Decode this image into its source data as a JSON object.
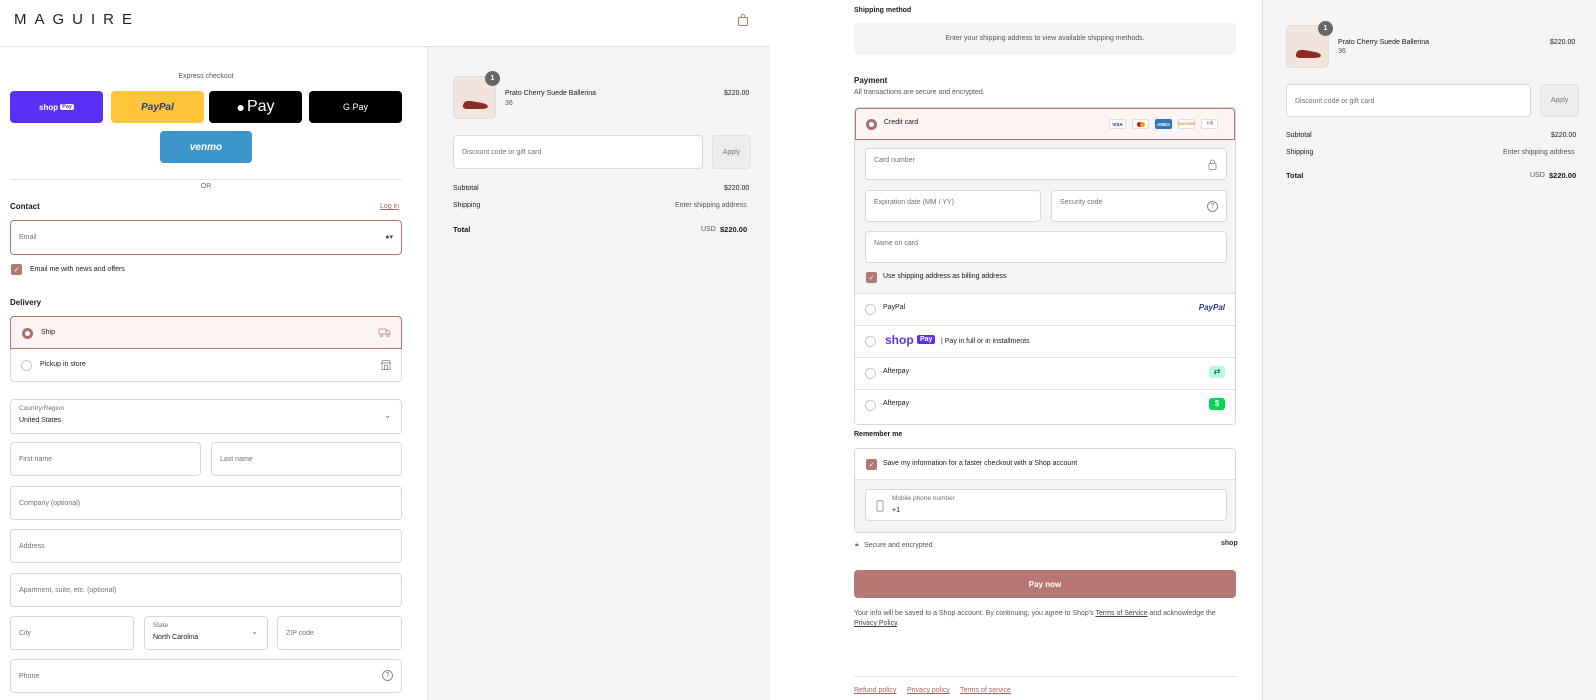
{
  "store": {
    "logo": "MAGUIRE"
  },
  "express": {
    "label": "Express checkout",
    "shop_pay": "shop",
    "shop_pay_badge": "Pay",
    "paypal": "PayPal",
    "apple_pay": "Pay",
    "google_pay": "G Pay",
    "venmo": "venmo",
    "or": "OR"
  },
  "contact": {
    "heading": "Contact",
    "login": "Log in",
    "email_placeholder": "Email",
    "news_label": "Email me with news and offers"
  },
  "delivery": {
    "heading": "Delivery",
    "ship": "Ship",
    "pickup": "Pickup in store",
    "country_label": "Country/Region",
    "country_value": "United States",
    "first_name": "First name",
    "last_name": "Last name",
    "company": "Company (optional)",
    "address": "Address",
    "apartment": "Apartment, suite, etc. (optional)",
    "city": "City",
    "state_label": "State",
    "state_value": "North Carolina",
    "zip": "ZIP code",
    "phone": "Phone"
  },
  "product": {
    "name": "Prato Cherry Suede Ballerina",
    "variant": "36",
    "price": "$220.00",
    "quantity": "1"
  },
  "summary": {
    "discount_placeholder": "Discount code or gift card",
    "apply": "Apply",
    "subtotal_label": "Subtotal",
    "subtotal_value": "$220.00",
    "shipping_label": "Shipping",
    "shipping_value": "Enter shipping address",
    "total_label": "Total",
    "currency": "USD",
    "total_value": "$220.00"
  },
  "shipping_method": {
    "heading": "Shipping method",
    "message": "Enter your shipping address to view available shipping methods."
  },
  "payment": {
    "heading": "Payment",
    "subheading": "All transactions are secure and encrypted.",
    "credit_card": "Credit card",
    "cards": [
      "VISA",
      "MC",
      "AMEX",
      "DISCOVER"
    ],
    "more_cards": "+4",
    "card_number": "Card number",
    "expiration": "Expiration date (MM / YY)",
    "security_code": "Security code",
    "name_on_card": "Name on card",
    "billing_same": "Use shipping address as billing address",
    "paypal": "PayPal",
    "paypal_logo": "PayPal",
    "shop_pay_logo": "shop",
    "shop_pay_badge": "Pay",
    "shop_pay_text": "| Pay in full or in installments",
    "afterpay_1": "Afterpay",
    "afterpay_2": "Afterpay"
  },
  "remember": {
    "heading": "Remember me",
    "save_label": "Save my information for a faster checkout with a Shop account",
    "mobile_label": "Mobile phone number",
    "mobile_value": "+1",
    "secure": "Secure and encrypted",
    "shop": "shop"
  },
  "pay_now": "Pay now",
  "legal": {
    "text_before": "Your info will be saved to a Shop account. By continuing, you agree to Shop's ",
    "terms_link": "Terms of Service",
    "text_middle": " and acknowledge the ",
    "privacy_link": "Privacy Policy",
    "text_end": "."
  },
  "footer": {
    "refund": "Refund policy",
    "privacy": "Privacy policy",
    "terms": "Terms of service"
  },
  "colors": {
    "accent": "#b57873",
    "shop_purple": "#5a31f4",
    "paypal_yellow": "#ffc439",
    "venmo_blue": "#3d95ce"
  }
}
